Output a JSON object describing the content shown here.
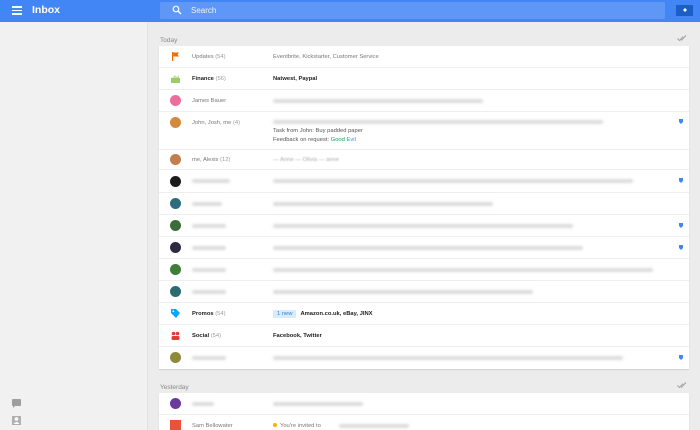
{
  "header": {
    "app_title": "Inbox",
    "search_placeholder": "Search"
  },
  "sections": {
    "today": "Today",
    "yesterday": "Yesterday"
  },
  "today_rows": {
    "updates": {
      "sender": "Updates",
      "count": "(54)",
      "subject": "Eventbrite, Kickstarter, Customer Service"
    },
    "finance": {
      "sender": "Finance",
      "count": "(56)",
      "subject": "Natwest, Paypal"
    },
    "james": {
      "sender": "James Bauer"
    },
    "john": {
      "sender": "John, Josh, me",
      "count": "(4)",
      "task": "Task from John: Buy padded paper",
      "feedback_label": "Feedback on request:",
      "good": "Good",
      "evil": "Evil"
    },
    "alexis": {
      "sender": "me, Alexis",
      "count": "(12)",
      "subject": "— Anne — Olivia — anne"
    },
    "promos": {
      "sender": "Promos",
      "count": "(54)",
      "badge": "1 new",
      "subject": "Amazon.co.uk, eBay, JINX"
    },
    "social": {
      "sender": "Social",
      "count": "(54)",
      "subject": "Facebook, Twitter"
    }
  },
  "yesterday_rows": {
    "sam": {
      "sender": "Sam Bellowater",
      "subject": "You're invited to"
    }
  },
  "colors": {
    "accent": "#4285f4",
    "accent_dark": "#1a5ec6",
    "updates": "#ef6c00",
    "finance": "#9ccc65",
    "promos": "#03a9f4",
    "social": "#e53935",
    "james": "#ec6d9a",
    "john": "#d28a3c",
    "alexis": "#c07f50"
  },
  "icons": [
    "menu-icon",
    "search-icon",
    "pin-icon",
    "flag-icon",
    "finance-icon",
    "promos-tag-icon",
    "social-icon",
    "check-all-icon",
    "chat-icon",
    "person-icon"
  ]
}
